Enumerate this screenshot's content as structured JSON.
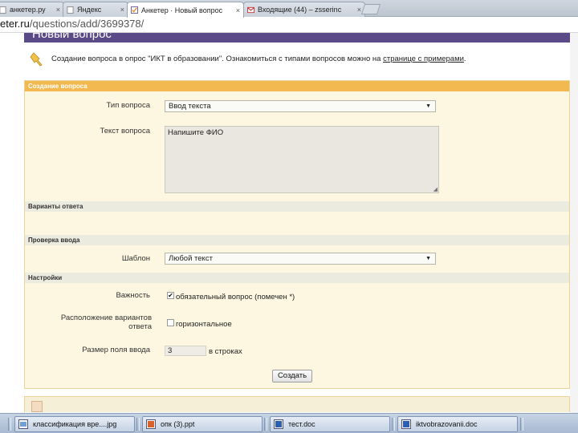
{
  "browser": {
    "tabs": [
      {
        "title": "анкетер.ру",
        "close": "×",
        "favicon": "page-icon"
      },
      {
        "title": "Яндекс",
        "close": "×",
        "favicon": "page-icon"
      },
      {
        "title": "Анкетер · Новый вопрос",
        "close": "×",
        "favicon": "anketer-icon"
      },
      {
        "title": "Входящие (44) – zsserinc",
        "close": "×",
        "favicon": "gmail-icon"
      }
    ],
    "url_domain": "eter.ru",
    "url_path": "/questions/add/3699378/"
  },
  "page": {
    "header_title": "Новый вопрос",
    "intro_text": "Создание вопроса в опрос \"ИКТ в образовании\". Ознакомиться с типами вопросов можно на ",
    "intro_link": "странице с примерами",
    "intro_end": "."
  },
  "form": {
    "section_create": "Создание вопроса",
    "question_type_label": "Тип вопроса",
    "question_type_value": "Ввод текста",
    "question_text_label": "Текст вопроса",
    "question_text_value": "Напишите ФИО",
    "section_answers": "Варианты ответа",
    "section_validation": "Проверка ввода",
    "template_label": "Шаблон",
    "template_value": "Любой текст",
    "section_settings": "Настройки",
    "importance_label": "Важность",
    "importance_text": "обязательный вопрос (помечен *)",
    "importance_checked": true,
    "layout_label_1": "Расположение вариантов",
    "layout_label_2": "ответа",
    "layout_text": "горизонтальное",
    "layout_checked": false,
    "field_size_label": "Размер поля ввода",
    "field_size_value": "3",
    "field_size_unit": "в строках",
    "submit_label": "Создать",
    "dropdown_arrow": "▼",
    "checkmark": "✔",
    "resize_grip": "◢"
  },
  "taskbar": {
    "items": [
      {
        "title": "классификация вре....jpg",
        "icon": "image-file-icon"
      },
      {
        "title": "опк (3).ppt",
        "icon": "powerpoint-icon"
      },
      {
        "title": "тест.doc",
        "icon": "word-doc-icon"
      },
      {
        "title": "iktvobrazovanii.doc",
        "icon": "word-doc-icon"
      }
    ]
  },
  "colors": {
    "header_purple": "#5b4a88",
    "section_orange": "#f2b950",
    "panel_bg": "#fdf6e0"
  }
}
